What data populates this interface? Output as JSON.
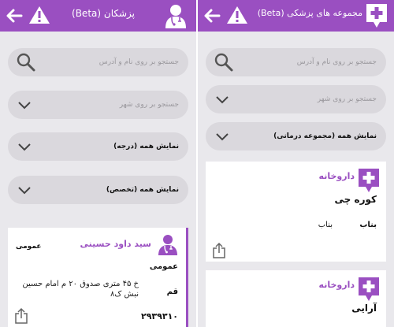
{
  "colors": {
    "accent": "#9a4fc1",
    "background": "#e9e8ec",
    "field": "#dad8dd"
  },
  "left_screen": {
    "header": {
      "title": "پزشکان (Beta)",
      "back_icon": "arrow-left-icon",
      "warning_icon": "warning-triangle-icon",
      "brand_icon": "doctor-icon"
    },
    "search": {
      "placeholder": "جستجو بر روی نام و آدرس"
    },
    "city_filter": {
      "placeholder": "جستجو بر روی شهر"
    },
    "degree_filter": {
      "value": "نمایش همه (درجه)"
    },
    "specialty_filter": {
      "value": "نمایش همه (تخصص)"
    },
    "doctor_card": {
      "name": "سید داود حسینی",
      "specialty_top": "عمومی",
      "specialty": "عمومی",
      "city": "قم",
      "address": "خ ۴۵ متری صدوق ۲۰ م امام حسین نبش ک۸",
      "phone": "۲۹۳۹۳۱۰"
    }
  },
  "right_screen": {
    "header": {
      "title": "مجموعه های پزشکی (Beta)",
      "back_icon": "arrow-left-icon",
      "warning_icon": "warning-triangle-icon",
      "brand_icon": "medical-plus-icon"
    },
    "search": {
      "placeholder": "جستجو بر روی نام و آدرس"
    },
    "city_filter": {
      "placeholder": "جستجو بر روی شهر"
    },
    "type_filter": {
      "value": "نمایش همه (مجموعه درمانی)"
    },
    "cards": [
      {
        "type": "داروخانه",
        "name": "کوره چی",
        "city": "بناب",
        "address": "بناب"
      },
      {
        "type": "داروخانه",
        "name": "آرایی"
      }
    ]
  }
}
